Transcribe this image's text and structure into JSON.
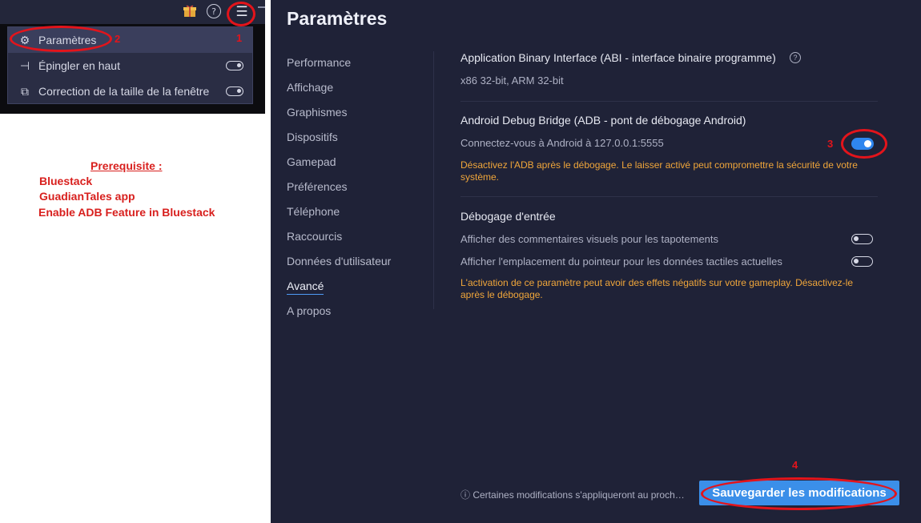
{
  "topbar": {
    "gift_icon": "gift-icon",
    "help_icon": "?",
    "menu_icon": "☰"
  },
  "menu": {
    "items": [
      {
        "icon": "⚙",
        "label": "Paramètres",
        "toggle": false
      },
      {
        "icon": "⊣",
        "label": "Épingler en haut",
        "toggle": true
      },
      {
        "icon": "⧉",
        "label": "Correction de la taille de la fenêtre",
        "toggle": true
      }
    ]
  },
  "annotations": {
    "step1": "1",
    "step2": "2",
    "step3": "3",
    "step4": "4",
    "prereq_title": "Prerequisite :",
    "prereq_items": [
      "Bluestack",
      "GuadianTales app",
      "Enable ADB Feature in Bluestack"
    ]
  },
  "settings": {
    "title": "Paramètres",
    "nav": [
      "Performance",
      "Affichage",
      "Graphismes",
      "Dispositifs",
      "Gamepad",
      "Préférences",
      "Téléphone",
      "Raccourcis",
      "Données d'utilisateur",
      "Avancé",
      "A propos"
    ],
    "active_nav": "Avancé",
    "abi": {
      "title": "Application Binary Interface (ABI - interface binaire programme)",
      "value": "x86 32-bit, ARM 32-bit"
    },
    "adb": {
      "title": "Android Debug Bridge (ADB - pont de débogage Android)",
      "connect": "Connectez-vous à Android à 127.0.0.1:5555",
      "warning": "Désactivez l'ADB après le débogage. Le laisser activé peut compromettre la sécurité de votre système.",
      "enabled": true
    },
    "input_debug": {
      "title": "Débogage d'entrée",
      "option1": "Afficher des commentaires visuels pour les tapotements",
      "option2": "Afficher l'emplacement du pointeur pour les données tactiles actuelles",
      "warning": "L'activation de ce paramètre peut avoir des effets négatifs sur votre gameplay. Désactivez-le après le débogage."
    },
    "footnote": "Certaines modifications s'appliqueront au proch…",
    "save_label": "Sauvegarder les modifications"
  },
  "colors": {
    "accent": "#3b8fe9",
    "warning": "#f0a63a",
    "annotation": "#e3141b",
    "panel": "#1f2237"
  }
}
